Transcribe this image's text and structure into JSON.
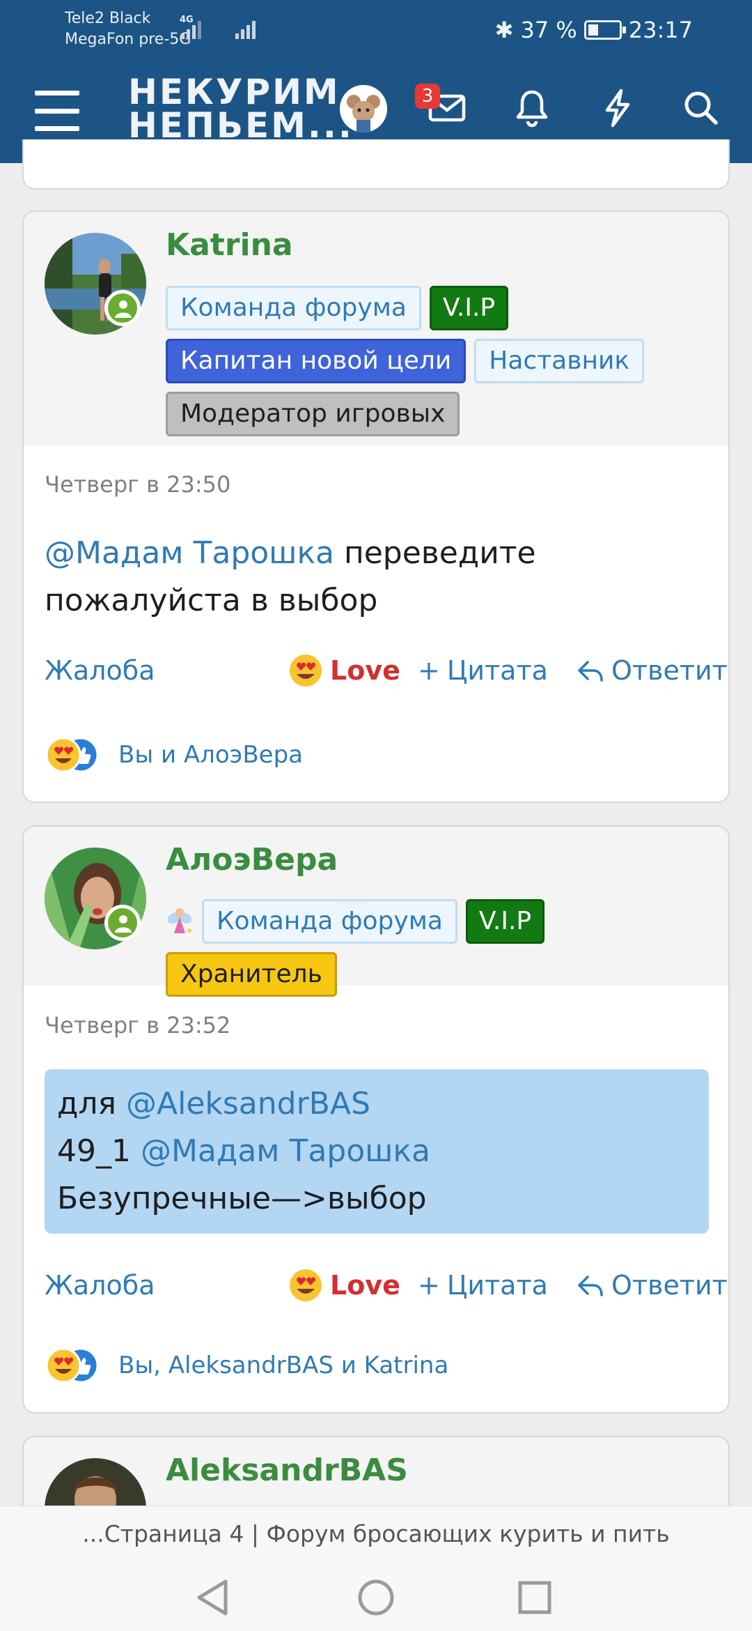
{
  "status_bar": {
    "carrier1": "Tele2 Black",
    "carrier2": "MegaFon pre-5G",
    "network": "4G",
    "battery": "37 %",
    "time": "23:17"
  },
  "header": {
    "logo_line1": "НЕКУРИМ",
    "logo_line2": "НЕПЬЕМ...",
    "messages_badge": "3",
    "icons": [
      "menu-icon",
      "avatar",
      "mail-icon",
      "bell-icon",
      "lightning-icon",
      "search-icon"
    ],
    "bg_color": "#1c5486"
  },
  "posts": [
    {
      "username": "Katrina",
      "tags": [
        "Команда форума",
        "V.I.P",
        "Капитан новой цели",
        "Наставник",
        "Модератор игровых"
      ],
      "timestamp": "Четверг в 23:50",
      "mention": "@Мадам Тарошка",
      "message_line1": " переведите",
      "message_line2": "пожалуйста в выбор",
      "actions": {
        "report": "Жалоба",
        "love": "Love",
        "quote": "Цитата",
        "reply": "Ответить"
      },
      "reactions_text": "Вы и АлоэВера"
    },
    {
      "username": "АлоэВера",
      "tags": [
        "Команда форума",
        "V.I.P",
        "Хранитель"
      ],
      "timestamp": "Четверг в 23:52",
      "quote_line1_text": "для ",
      "quote_line1_mention": "@AleksandrBAS",
      "quote_line2_text": "49_1 ",
      "quote_line2_mention": "@Мадам Тарошка",
      "quote_line3": "Безупречные—>выбор",
      "actions": {
        "report": "Жалоба",
        "love": "Love",
        "quote": "Цитата",
        "reply": "Ответить"
      },
      "reactions_text": "Вы, AleksandrBAS и Katrina"
    },
    {
      "username": "AleksandrBAS"
    }
  ],
  "bottom": {
    "page_title": "...Страница 4 | Форум бросающих курить и пить",
    "nav": [
      "back-icon",
      "home-icon",
      "recents-icon"
    ]
  }
}
